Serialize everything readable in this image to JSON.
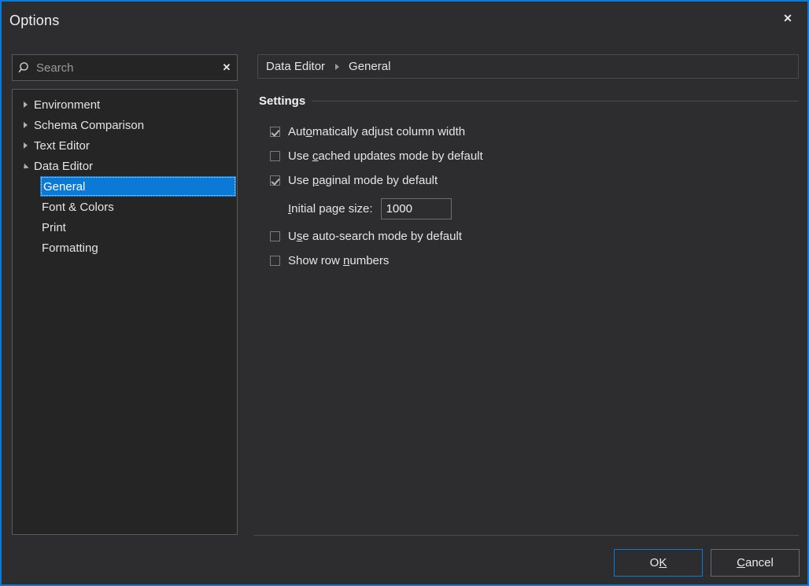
{
  "window": {
    "title": "Options",
    "close_icon": "close-icon",
    "close_label": "✕",
    "accent_color": "#0a7ad6",
    "background_color": "#2d2d30",
    "panel_color": "#252526"
  },
  "search": {
    "icon": "search-icon",
    "placeholder": "Search",
    "value": "",
    "clear_label": "✕"
  },
  "tree": {
    "items": [
      {
        "label": "Environment",
        "level": 0,
        "state": "collapsed",
        "selected": false
      },
      {
        "label": "Schema Comparison",
        "level": 0,
        "state": "collapsed",
        "selected": false
      },
      {
        "label": "Text Editor",
        "level": 0,
        "state": "collapsed",
        "selected": false
      },
      {
        "label": "Data Editor",
        "level": 0,
        "state": "expanded",
        "selected": false
      },
      {
        "label": "General",
        "level": 1,
        "state": "leaf",
        "selected": true
      },
      {
        "label": "Font & Colors",
        "level": 1,
        "state": "leaf",
        "selected": false
      },
      {
        "label": "Print",
        "level": 1,
        "state": "leaf",
        "selected": false
      },
      {
        "label": "Formatting",
        "level": 1,
        "state": "leaf",
        "selected": false
      }
    ]
  },
  "breadcrumb": {
    "root": "Data Editor",
    "separator": "▸",
    "current": "General"
  },
  "settings": {
    "group_title": "Settings",
    "checkboxes": [
      {
        "label": "Automatically adjust column width",
        "pre": "Aut",
        "mnemonic": "o",
        "post": "matically adjust column width",
        "checked": true
      },
      {
        "label": "Use cached updates mode by default",
        "pre": "Use ",
        "mnemonic": "c",
        "post": "ached updates mode by default",
        "checked": false
      },
      {
        "label": "Use paginal mode by default",
        "pre": "Use ",
        "mnemonic": "p",
        "post": "aginal mode by default",
        "checked": true
      }
    ],
    "page_size": {
      "label": "Initial page size:",
      "label_mnemonic": "I",
      "label_post": "nitial page size:",
      "value": "1000"
    },
    "checkboxes_after": [
      {
        "label": "Use auto-search mode by default",
        "pre": "U",
        "mnemonic": "s",
        "post": "e auto-search mode by default",
        "checked": false
      },
      {
        "label": "Show row numbers",
        "pre": "Show row ",
        "mnemonic": "n",
        "post": "umbers",
        "checked": false
      }
    ]
  },
  "footer": {
    "ok_pre": "O",
    "ok_mnemonic": "K",
    "ok_label": "OK",
    "cancel_mnemonic": "C",
    "cancel_post": "ancel",
    "cancel_label": "Cancel"
  }
}
